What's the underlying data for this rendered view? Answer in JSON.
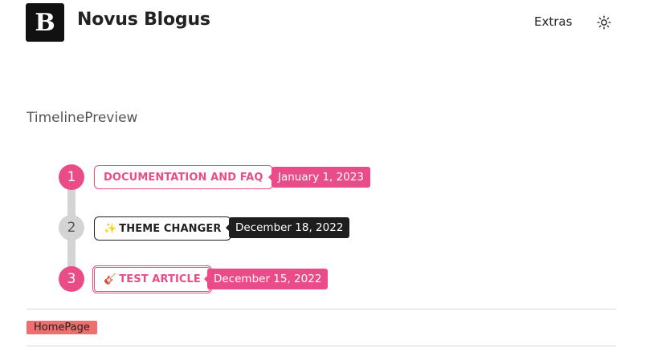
{
  "header": {
    "logo_letter": "B",
    "site_title": "Novus Blogus",
    "nav": {
      "extras_label": "Extras"
    }
  },
  "main": {
    "section_title": "TimelinePreview",
    "timeline": [
      {
        "number": "1",
        "title": "DOCUMENTATION AND FAQ",
        "emoji": "",
        "date": "January 1, 2023"
      },
      {
        "number": "2",
        "title": "THEME CHANGER",
        "emoji": "✨",
        "date": "December 18, 2022"
      },
      {
        "number": "3",
        "title": "TEST ARTICLE",
        "emoji": "🎸",
        "date": "December 15, 2022"
      }
    ]
  },
  "footer": {
    "tag_label": "HomePage"
  },
  "colors": {
    "accent": "#ea4c89",
    "dark": "#1e1e1e",
    "tag": "#f06e6e",
    "line": "#d4d4d4"
  },
  "icons": {
    "theme_toggle": "sun-icon"
  }
}
